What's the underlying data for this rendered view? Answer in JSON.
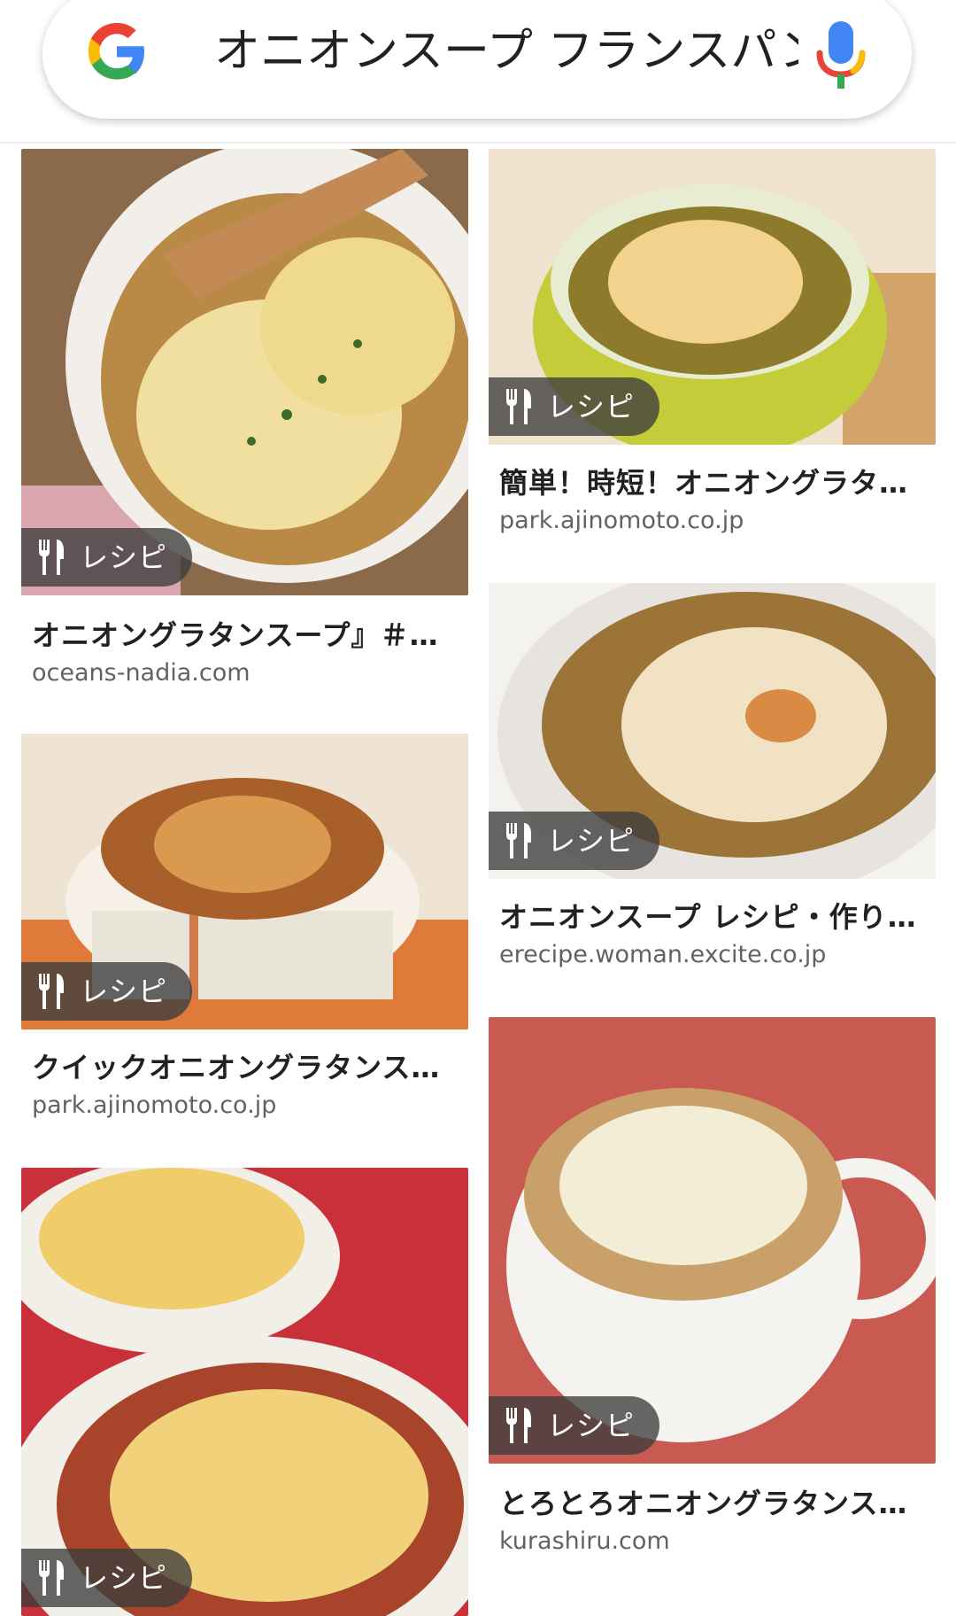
{
  "search": {
    "query": "オニオンスープ フランスパン"
  },
  "results": [
    {
      "badge": "レシピ",
      "title": "オニオングラタンスープ』＃…",
      "domain": "oceans-nadia.com"
    },
    {
      "badge": "レシピ",
      "title": "簡単！時短！オニオングラタ…",
      "domain": "park.ajinomoto.co.jp"
    },
    {
      "badge": "レシピ",
      "title": "オニオンスープ レシピ・作り…",
      "domain": "erecipe.woman.excite.co.jp"
    },
    {
      "badge": "レシピ",
      "title": "クイックオニオングラタンス…",
      "domain": "park.ajinomoto.co.jp"
    },
    {
      "badge": "レシピ",
      "title": "とろとろオニオングラタンス…",
      "domain": "kurashiru.com"
    },
    {
      "badge": "レシピ"
    }
  ],
  "colors": {
    "google_blue": "#4285F4",
    "google_red": "#EA4335",
    "google_yellow": "#FBBC05",
    "google_green": "#34A853"
  }
}
